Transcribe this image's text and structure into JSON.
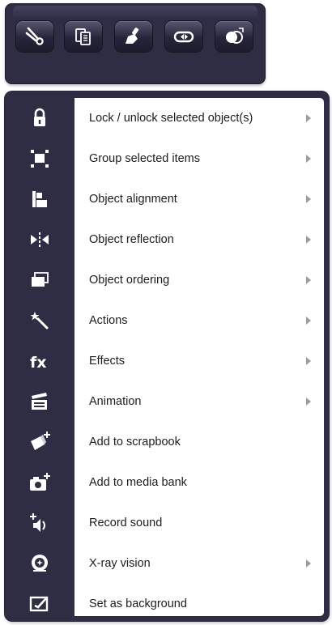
{
  "toolbar": {
    "buttons": [
      {
        "name": "cut",
        "icon": "scissors-icon"
      },
      {
        "name": "copy",
        "icon": "copy-icon"
      },
      {
        "name": "paste",
        "icon": "paste-brush-icon"
      },
      {
        "name": "link",
        "icon": "link-icon"
      },
      {
        "name": "transparency",
        "icon": "transparency-icon"
      }
    ]
  },
  "menu": {
    "items": [
      {
        "label": "Lock / unlock selected object(s)",
        "icon": "lock-icon",
        "submenu": true
      },
      {
        "label": "Group selected items",
        "icon": "group-icon",
        "submenu": true
      },
      {
        "label": "Object alignment",
        "icon": "align-icon",
        "submenu": true
      },
      {
        "label": "Object reflection",
        "icon": "reflect-icon",
        "submenu": true
      },
      {
        "label": "Object ordering",
        "icon": "order-icon",
        "submenu": true
      },
      {
        "label": "Actions",
        "icon": "magic-wand-icon",
        "submenu": true
      },
      {
        "label": "Effects",
        "icon": "fx-icon",
        "submenu": true
      },
      {
        "label": "Animation",
        "icon": "clapperboard-icon",
        "submenu": true
      },
      {
        "label": "Add to scrapbook",
        "icon": "scrapbook-add-icon",
        "submenu": false
      },
      {
        "label": "Add to media bank",
        "icon": "camera-add-icon",
        "submenu": false
      },
      {
        "label": "Record sound",
        "icon": "record-sound-icon",
        "submenu": false
      },
      {
        "label": "X-ray vision",
        "icon": "xray-icon",
        "submenu": true
      },
      {
        "label": "Set as background",
        "icon": "background-icon",
        "submenu": false
      }
    ]
  },
  "colors": {
    "panel": "#2e2d44",
    "menu_background": "#ffffff",
    "label_text": "#1c1c1c",
    "submenu_arrow": "#9d9d9d",
    "icon_fill": "#ffffff"
  }
}
